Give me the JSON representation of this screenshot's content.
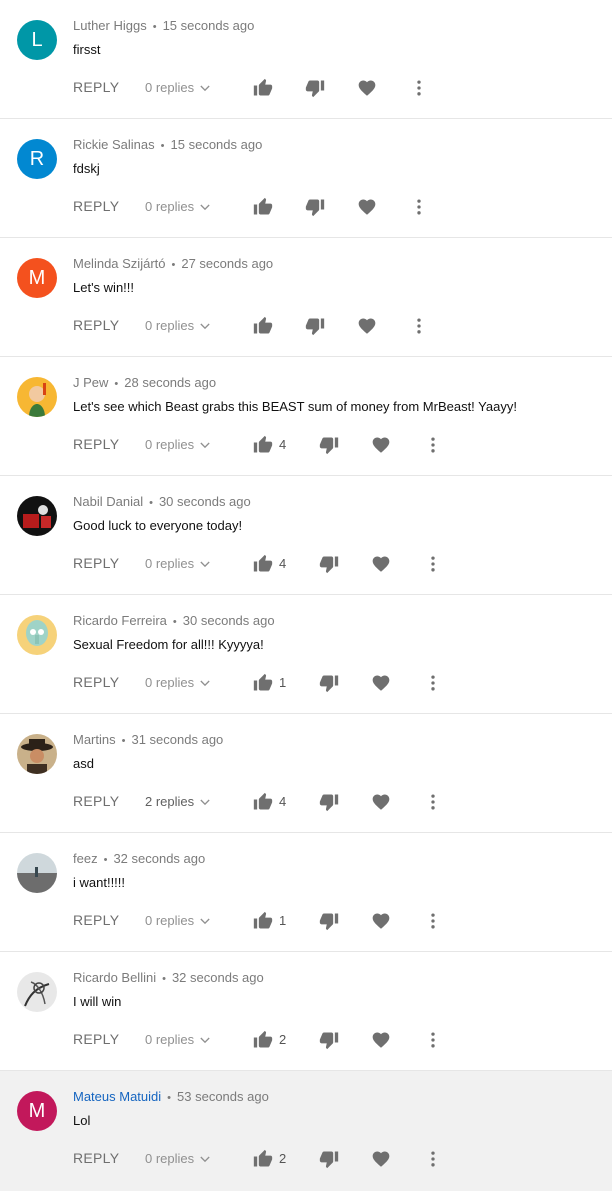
{
  "labels": {
    "reply": "REPLY"
  },
  "comments": [
    {
      "author": "Luther Higgs",
      "time": "15 seconds ago",
      "text": "firsst",
      "replies": "0 replies",
      "likes": "",
      "avatar": {
        "kind": "letter",
        "letter": "L",
        "color": "#0097a7"
      }
    },
    {
      "author": "Rickie Salinas",
      "time": "15 seconds ago",
      "text": "fdskj",
      "replies": "0 replies",
      "likes": "",
      "avatar": {
        "kind": "letter",
        "letter": "R",
        "color": "#0288d1"
      }
    },
    {
      "author": "Melinda Szijártó",
      "time": "27 seconds ago",
      "text": "Let's win!!!",
      "replies": "0 replies",
      "likes": "",
      "avatar": {
        "kind": "letter",
        "letter": "M",
        "color": "#f4511e"
      }
    },
    {
      "author": "J Pew",
      "time": "28 seconds ago",
      "text": "Let's see which Beast grabs this BEAST sum of money from MrBeast! Yaayy!",
      "replies": "0 replies",
      "likes": "4",
      "avatar": {
        "kind": "image",
        "style": "cartoon-yellow"
      }
    },
    {
      "author": "Nabil Danial",
      "time": "30 seconds ago",
      "text": "Good luck to everyone today!",
      "replies": "0 replies",
      "likes": "4",
      "avatar": {
        "kind": "image",
        "style": "dark-red"
      }
    },
    {
      "author": "Ricardo Ferreira",
      "time": "30 seconds ago",
      "text": "Sexual Freedom for all!!! Kyyyya!",
      "replies": "0 replies",
      "likes": "1",
      "avatar": {
        "kind": "image",
        "style": "squidward"
      }
    },
    {
      "author": "Martins",
      "time": "31 seconds ago",
      "text": "asd",
      "replies": "2 replies",
      "likes": "4",
      "avatar": {
        "kind": "image",
        "style": "cowboy"
      }
    },
    {
      "author": "feez",
      "time": "32 seconds ago",
      "text": "i want!!!!!",
      "replies": "0 replies",
      "likes": "1",
      "avatar": {
        "kind": "image",
        "style": "beach"
      }
    },
    {
      "author": "Ricardo Bellini",
      "time": "32 seconds ago",
      "text": "I will win",
      "replies": "0 replies",
      "likes": "2",
      "avatar": {
        "kind": "image",
        "style": "sketch"
      }
    },
    {
      "author": "Mateus Matuidi",
      "time": "53 seconds ago",
      "text": "Lol",
      "replies": "0 replies",
      "likes": "2",
      "avatar": {
        "kind": "letter",
        "letter": "M",
        "color": "#c2185b"
      },
      "highlight": true
    }
  ],
  "colors": {
    "icon": "#6f6f6f",
    "author_link": "#1565c0",
    "highlight_bg": "#f1f1f1"
  },
  "icons": [
    "thumb-up-icon",
    "thumb-down-icon",
    "heart-icon",
    "more-vert-icon",
    "chevron-down-icon"
  ]
}
